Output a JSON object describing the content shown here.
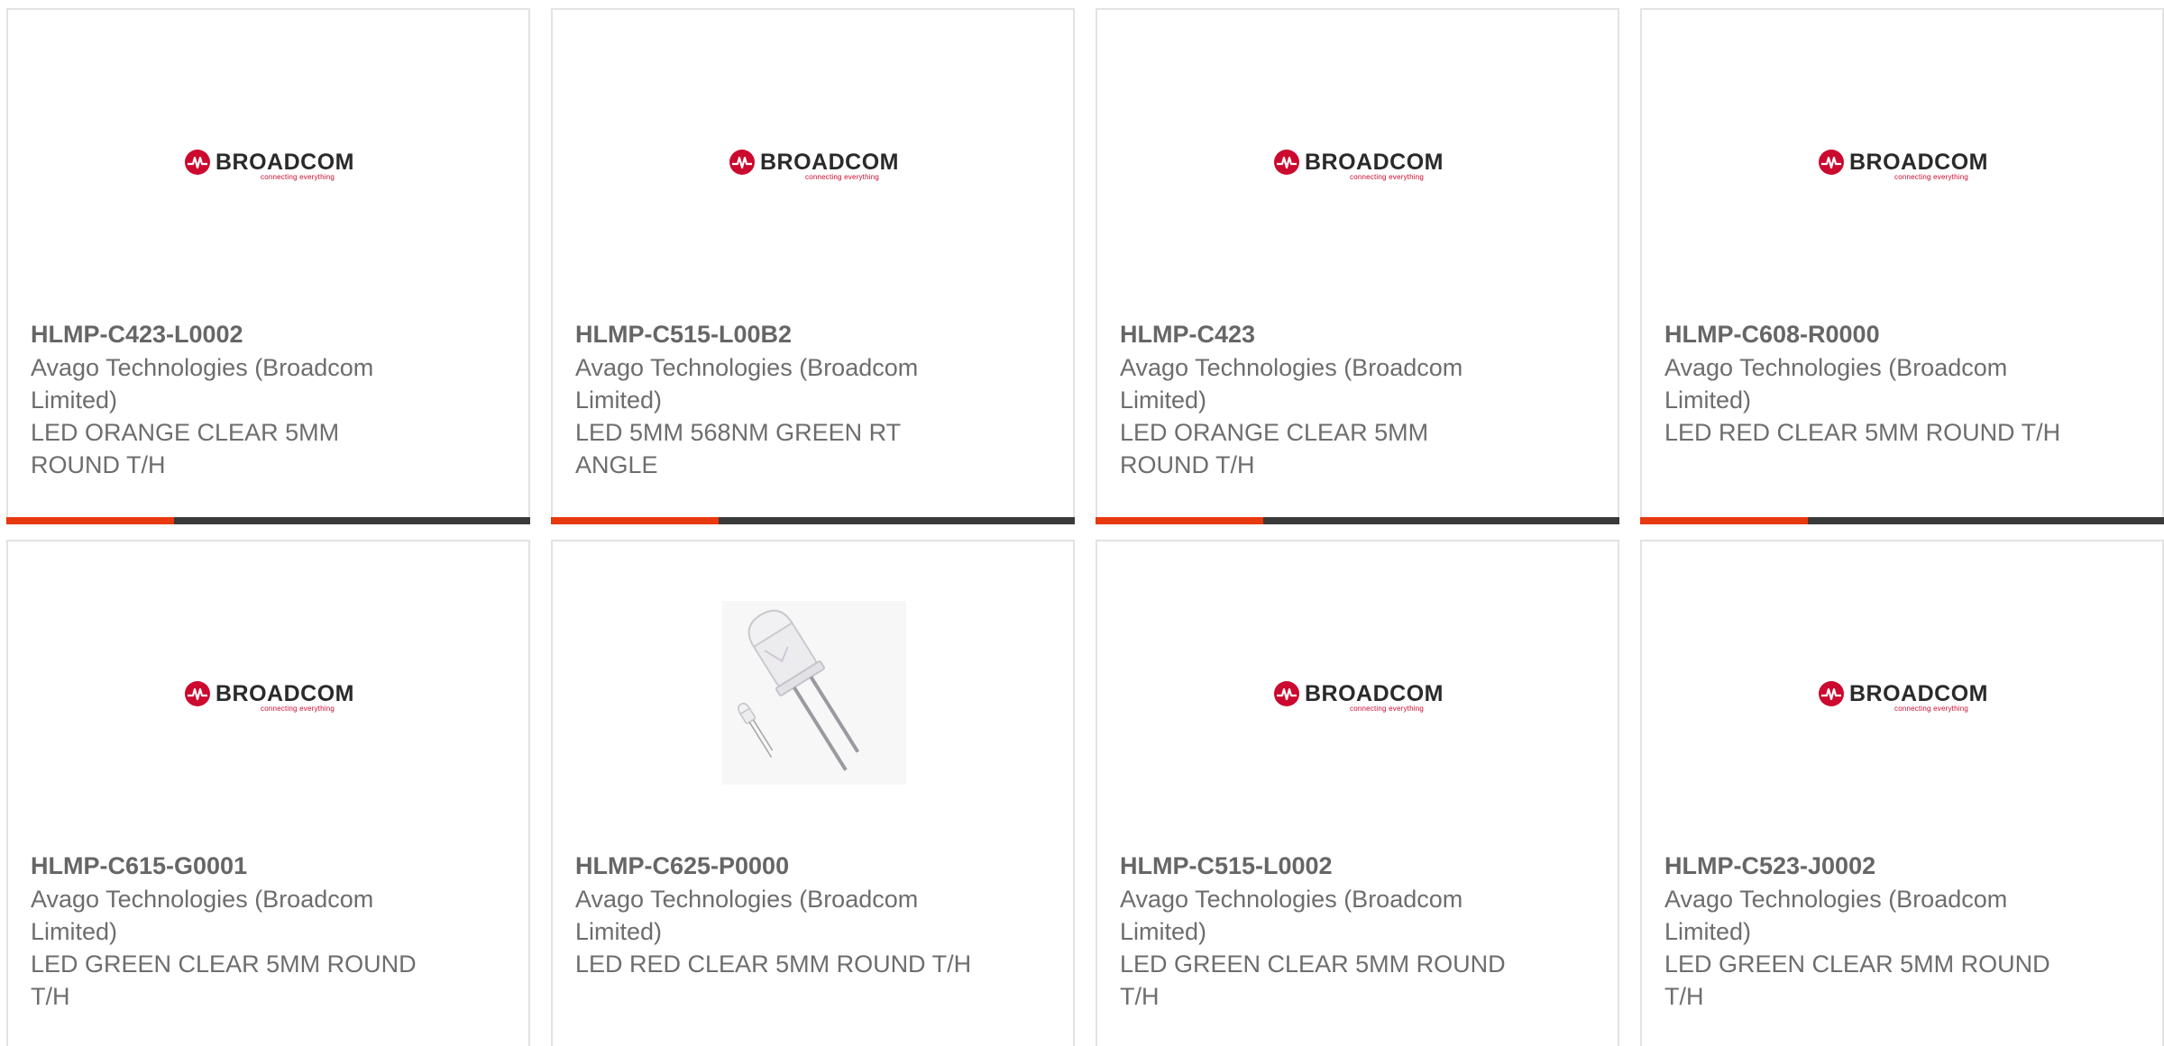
{
  "products": [
    {
      "part_number": "HLMP-C423-L0002",
      "manufacturer": "Avago Technologies (Broadcom Limited)",
      "description": "LED ORANGE CLEAR 5MM ROUND T/H",
      "image": "broadcom-logo",
      "progress": 0.32
    },
    {
      "part_number": "HLMP-C515-L00B2",
      "manufacturer": "Avago Technologies (Broadcom Limited)",
      "description": "LED 5MM 568NM GREEN RT ANGLE",
      "image": "broadcom-logo",
      "progress": 0.32
    },
    {
      "part_number": "HLMP-C423",
      "manufacturer": "Avago Technologies (Broadcom Limited)",
      "description": "LED ORANGE CLEAR 5MM ROUND T/H",
      "image": "broadcom-logo",
      "progress": 0.32
    },
    {
      "part_number": "HLMP-C608-R0000",
      "manufacturer": "Avago Technologies (Broadcom Limited)",
      "description": "LED RED CLEAR 5MM ROUND T/H",
      "image": "broadcom-logo",
      "progress": 0.32
    },
    {
      "part_number": "HLMP-C615-G0001",
      "manufacturer": "Avago Technologies (Broadcom Limited)",
      "description": "LED GREEN CLEAR 5MM ROUND T/H",
      "image": "broadcom-logo"
    },
    {
      "part_number": "HLMP-C625-P0000",
      "manufacturer": "Avago Technologies (Broadcom Limited)",
      "description": "LED RED CLEAR 5MM ROUND T/H",
      "image": "led-photo"
    },
    {
      "part_number": "HLMP-C515-L0002",
      "manufacturer": "Avago Technologies (Broadcom Limited)",
      "description": "LED GREEN CLEAR 5MM ROUND T/H",
      "image": "broadcom-logo"
    },
    {
      "part_number": "HLMP-C523-J0002",
      "manufacturer": "Avago Technologies (Broadcom Limited)",
      "description": "LED GREEN CLEAR 5MM ROUND T/H",
      "image": "broadcom-logo"
    }
  ],
  "logo": {
    "wordmark": "BROADCOM",
    "tagline": "connecting everything"
  },
  "colors": {
    "accent": "#e8380d",
    "bar": "#3a3a3a",
    "brand_red": "#cc092f",
    "text": "#6d6d6d"
  }
}
